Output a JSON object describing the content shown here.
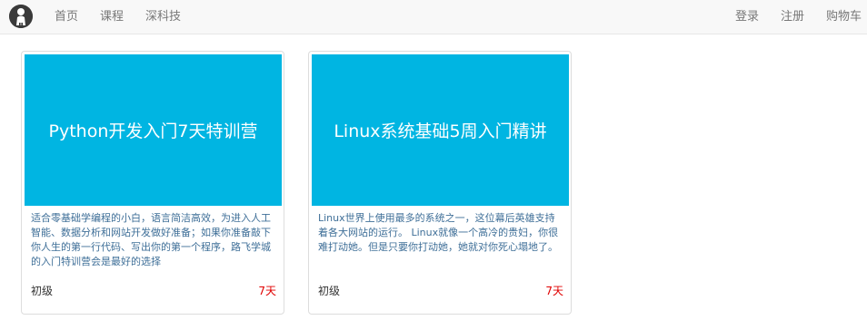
{
  "nav": {
    "logo_icon": "person-logo-icon",
    "left": [
      {
        "label": "首页"
      },
      {
        "label": "课程"
      },
      {
        "label": "深科技"
      }
    ],
    "right": [
      {
        "label": "登录"
      },
      {
        "label": "注册"
      },
      {
        "label": "购物车"
      }
    ]
  },
  "courses": [
    {
      "title": "Python开发入门7天特训营",
      "description": "适合零基础学编程的小白，语言简洁高效，为进入人工智能、数据分析和网站开发做好准备；如果你准备敲下你人生的第一行代码、写出你的第一个程序，路飞学城的入门特训营会是最好的选择",
      "level": "初级",
      "duration": "7天"
    },
    {
      "title": "Linux系统基础5周入门精讲",
      "description": "Linux世界上使用最多的系统之一，这位幕后英雄支持着各大网站的运行。 Linux就像一个高冷的贵妇，你很难打动她。但是只要你打动她，她就对你死心塌地了。",
      "level": "初级",
      "duration": "7天"
    }
  ],
  "colors": {
    "banner": "#00b5e2",
    "description_text": "#3f6f98",
    "duration_text": "#e00000",
    "navbar_bg": "#f8f8f8"
  }
}
